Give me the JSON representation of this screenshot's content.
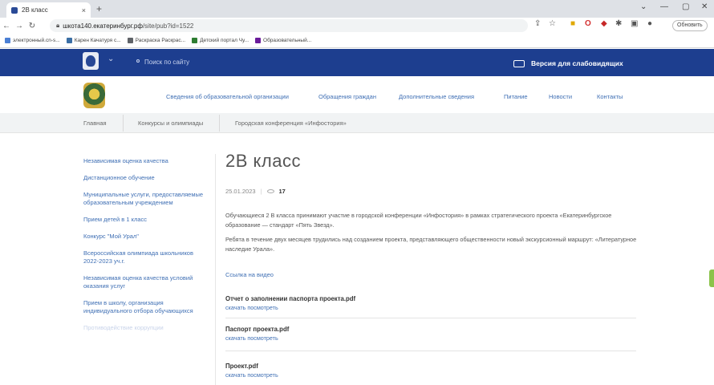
{
  "browser": {
    "tab_title": "2В класс",
    "tab_close": "×",
    "new_tab": "+",
    "url_domain": "шкотa140.екатеринбург.рф",
    "url_path": "/site/pub?id=1522",
    "update_button": "Обновить",
    "bookmarks": [
      {
        "label": "электронный.сn-s...",
        "color": "#4a7fd4"
      },
      {
        "label": "Карен Качатуря с...",
        "color": "#3a6ea5"
      },
      {
        "label": "Раскраска Раскрас...",
        "color": "#5f6368"
      },
      {
        "label": "Детский портал Чу...",
        "color": "#2e7d32"
      },
      {
        "label": "Образовательный...",
        "color": "#6a1b9a"
      }
    ]
  },
  "site": {
    "search_label": "Поиск по сайту",
    "visually_impaired": "Версия для слабовидящих",
    "menu": [
      "Сведения об образовательной организации",
      "Обращения граждан",
      "Дополнительные сведения",
      "Питание",
      "Новости",
      "Контакты"
    ],
    "breadcrumb": [
      "Главная",
      "Конкурсы и олимпиады",
      "Городская конференция «Инфостория»"
    ]
  },
  "sidebar": {
    "items": [
      "Независимая оценка качества",
      "Дистанционное обучение",
      "Муниципальные услуги, предоставляемые образовательным учреждением",
      "Прием детей в 1 класс",
      "Конкурс \"Мой Урал\"",
      "Всероссийская олимпиада школьников 2022-2023 уч.г.",
      "Независимая оценка качества условий оказания услуг",
      "Прием в школу, организация индивидуального отбора обучающихся",
      "Противодействие коррупции"
    ]
  },
  "article": {
    "title": "2В класс",
    "date": "25.01.2023",
    "views": "17",
    "para1": "Обучающиеся 2 В класса принимают участие в городской конференции «Инфостория» в рамках стратегического проекта «Екатеринбургское образование — стандарт «Пять Звезд».",
    "para2": "Ребята в течение двух месяцев трудились над созданием проекта, представляющего общественности новый экскурсионный маршрут: «Литературное наследие Урала».",
    "video_link": "Ссылка на видео",
    "documents": [
      {
        "title": "Отчет о заполнении паспорта проекта.pdf",
        "actions": "скачать посмотреть"
      },
      {
        "title": "Паспорт проекта.pdf",
        "actions": "скачать посмотреть"
      },
      {
        "title": "Проект.pdf",
        "actions": "скачать посмотреть"
      }
    ]
  }
}
